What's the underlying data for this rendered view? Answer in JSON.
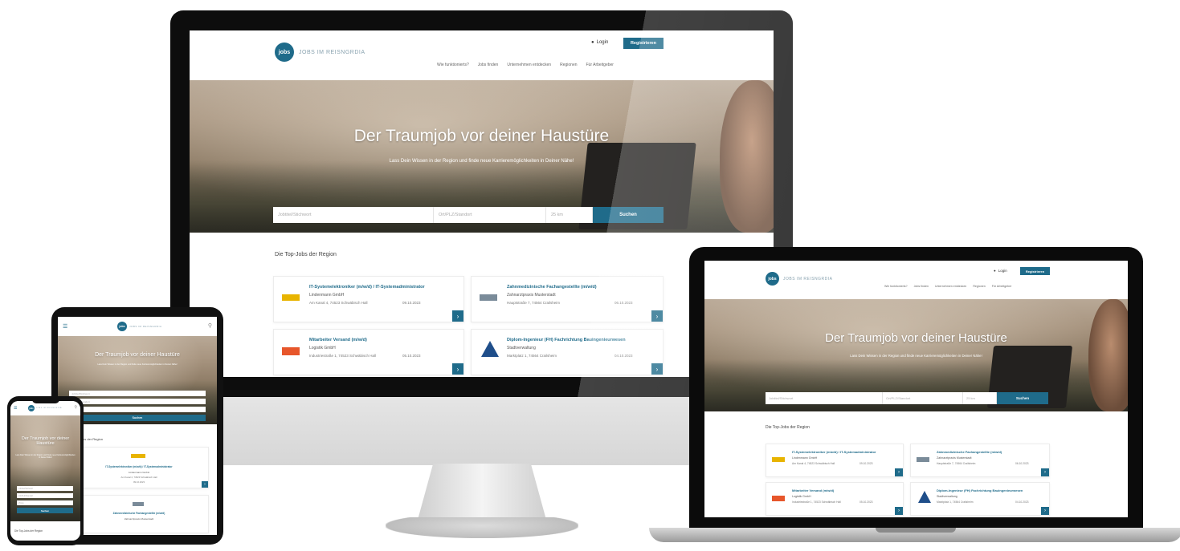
{
  "brand": {
    "badge": "jobs",
    "name": "JOBS IM REISNGRDIA",
    "color": "#1f6b8a"
  },
  "header": {
    "login": "Login",
    "register": "Registrieren",
    "nav": [
      "Wie funktionierts?",
      "Jobs finden",
      "Unternehmen entdecken",
      "Regionen",
      "Für Arbeitgeber"
    ]
  },
  "hero": {
    "title": "Der Traumjob vor deiner Haustüre",
    "subtitle": "Lass Dein Wissen in der Region und finde neue Karrieremöglichkeiten in Deiner Nähe!"
  },
  "search": {
    "keyword_placeholder": "Jobtitel/Stichwort",
    "location_placeholder": "Ort/PLZ/Standort",
    "radius": "25 km",
    "button": "Suchen"
  },
  "section_title": "Die Top-Jobs der Region",
  "jobs": [
    {
      "title": "IT-Systemelektroniker (m/w/d) / IT-Systemadministrator",
      "company": "Lindenmann GmbH",
      "location": "Am Kanal 4, 74523 Schwäbisch Hall",
      "date": "09.10.2023",
      "logo_color": "#e8b400"
    },
    {
      "title": "Zahnmedizinische Fachangestellte (m/w/d)",
      "company": "Zahnarztpraxis Musterstadt",
      "location": "Hauptstraße 7, 74564 Crailsheim",
      "date": "06.10.2023",
      "logo_color": "#7a8b99"
    },
    {
      "title": "Mitarbeiter Versand (m/w/d)",
      "company": "Logistik GmbH",
      "location": "Industriestraße 1, 74523 Schwäbisch Hall",
      "date": "05.10.2023",
      "logo_color": "#e7562b"
    },
    {
      "title": "Diplom-Ingenieur (FH) Fachrichtung Bauingenieurwesen",
      "company": "Stadtverwaltung",
      "location": "Marktplatz 1, 74564 Crailsheim",
      "date": "04.10.2023",
      "logo_color": "#1f4e8a"
    }
  ],
  "mobile": {
    "hero_title": "Der Traumjob vor deiner Haustüre",
    "section_title": "Die Top-Jobs der Region"
  }
}
